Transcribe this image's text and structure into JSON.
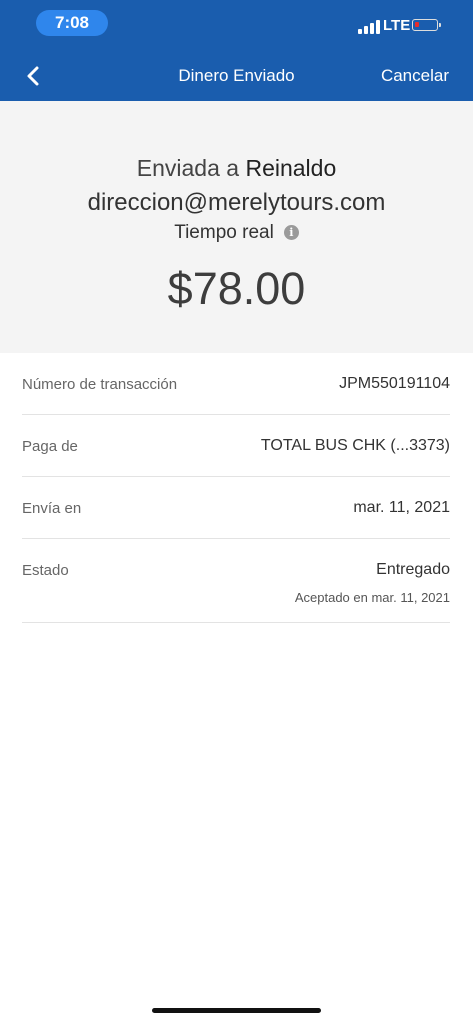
{
  "status_bar": {
    "time": "7:08",
    "network": "LTE",
    "battery_color": "#e52b2b"
  },
  "nav": {
    "back_icon": "chevron-left-icon",
    "title": "Dinero Enviado",
    "cancel_label": "Cancelar"
  },
  "summary": {
    "sent_prefix": "Enviada a",
    "recipient_name": "Reinaldo",
    "recipient_email": "direccion@merelytours.com",
    "speed": "Tiempo real",
    "info_icon": "info-icon",
    "amount": "$78.00"
  },
  "details": [
    {
      "label": "Número de transacción",
      "value": "JPM550191104"
    },
    {
      "label": "Paga de",
      "value": "TOTAL BUS CHK (...3373)"
    },
    {
      "label": "Envía en",
      "value": "mar. 11, 2021"
    },
    {
      "label": "Estado",
      "value": "Entregado",
      "subvalue": "Aceptado en mar. 11, 2021"
    }
  ],
  "colors": {
    "header_blue": "#1a5dae",
    "time_pill_blue": "#2f86ec",
    "summary_bg": "#f4f4f4"
  }
}
